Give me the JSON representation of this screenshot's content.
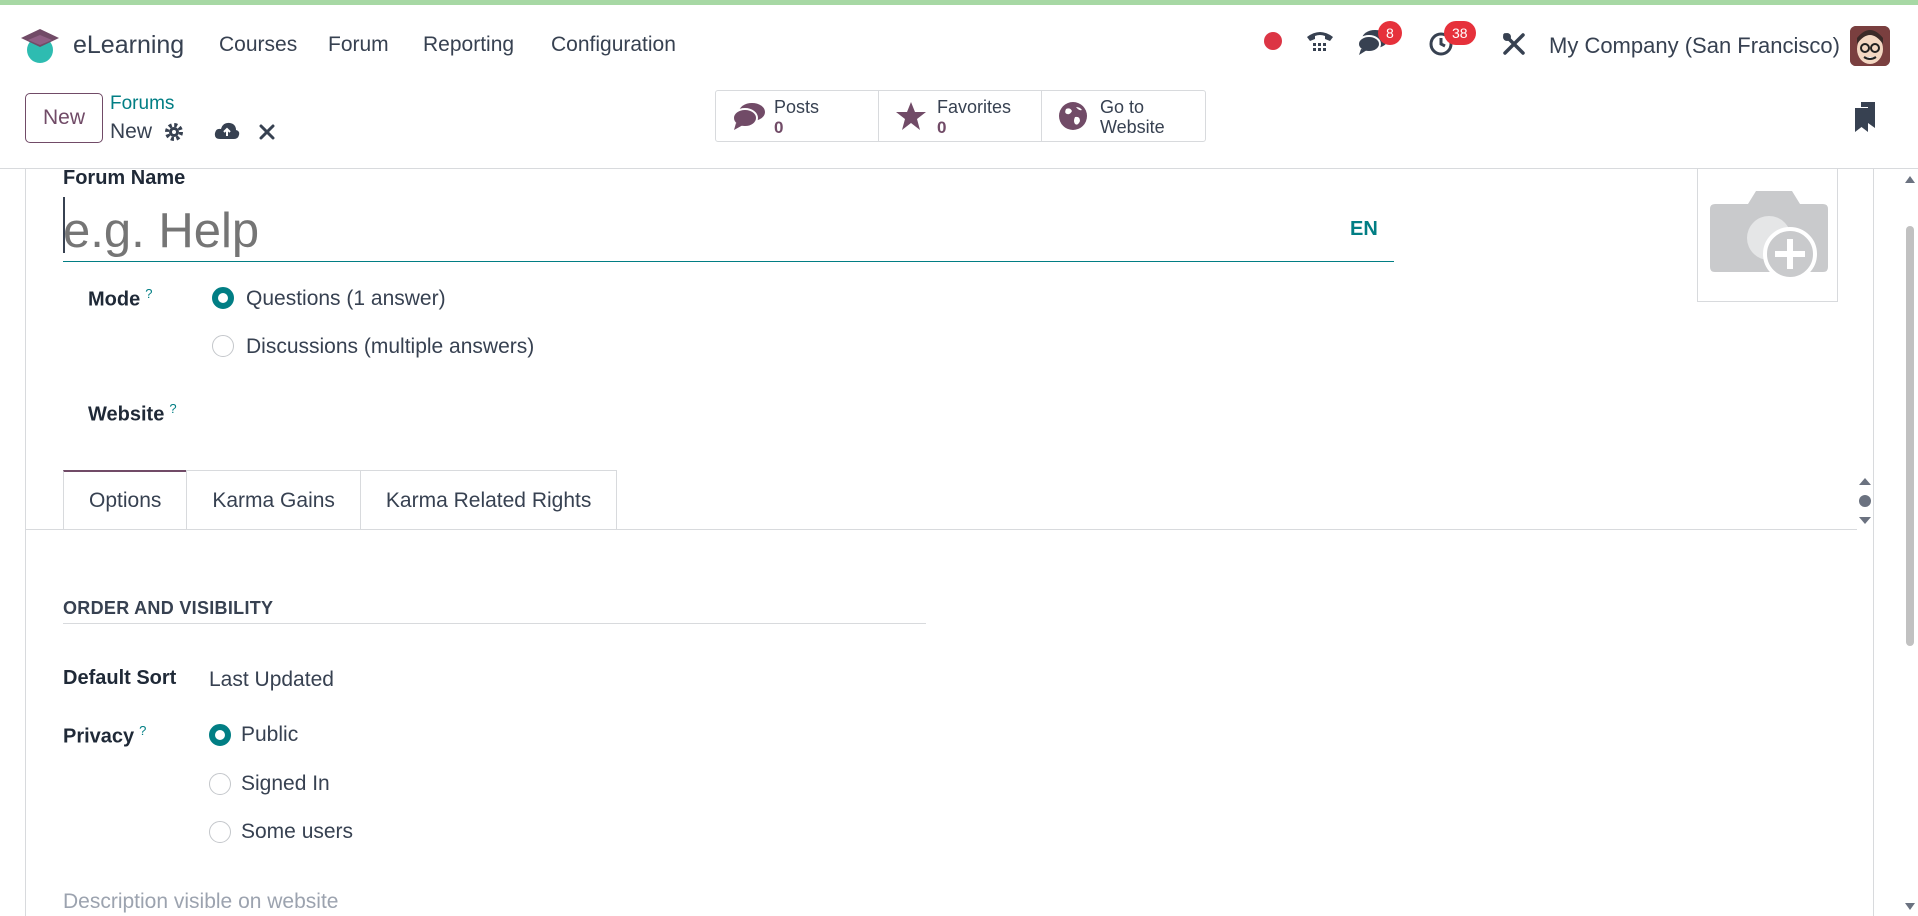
{
  "app": {
    "name": "eLearning"
  },
  "menu": [
    "Courses",
    "Forum",
    "Reporting",
    "Configuration"
  ],
  "systray": {
    "messages_count": "8",
    "activities_count": "38",
    "company": "My Company (San Francisco)"
  },
  "control": {
    "new_label": "New",
    "breadcrumb_parent": "Forums",
    "breadcrumb_current": "New"
  },
  "smart_buttons": [
    {
      "label": "Posts",
      "value": "0",
      "icon": "comments-icon"
    },
    {
      "label": "Favorites",
      "value": "0",
      "icon": "star-icon"
    },
    {
      "label": "Go to",
      "label2": "Website",
      "icon": "globe-icon"
    }
  ],
  "form": {
    "name_label": "Forum Name",
    "name_placeholder": "e.g. Help",
    "lang": "EN",
    "mode_label": "Mode",
    "mode_options": [
      "Questions (1 answer)",
      "Discussions (multiple answers)"
    ],
    "mode_selected": "Questions (1 answer)",
    "website_label": "Website",
    "tabs": [
      "Options",
      "Karma Gains",
      "Karma Related Rights"
    ],
    "active_tab": "Options",
    "section_title": "ORDER AND VISIBILITY",
    "default_sort_label": "Default Sort",
    "default_sort_value": "Last Updated",
    "privacy_label": "Privacy",
    "privacy_options": [
      "Public",
      "Signed In",
      "Some users"
    ],
    "privacy_selected": "Public",
    "description_placeholder": "Description visible on website"
  },
  "colors": {
    "brand": "#714b67",
    "accent": "#017e84",
    "badge": "#e6313b"
  }
}
